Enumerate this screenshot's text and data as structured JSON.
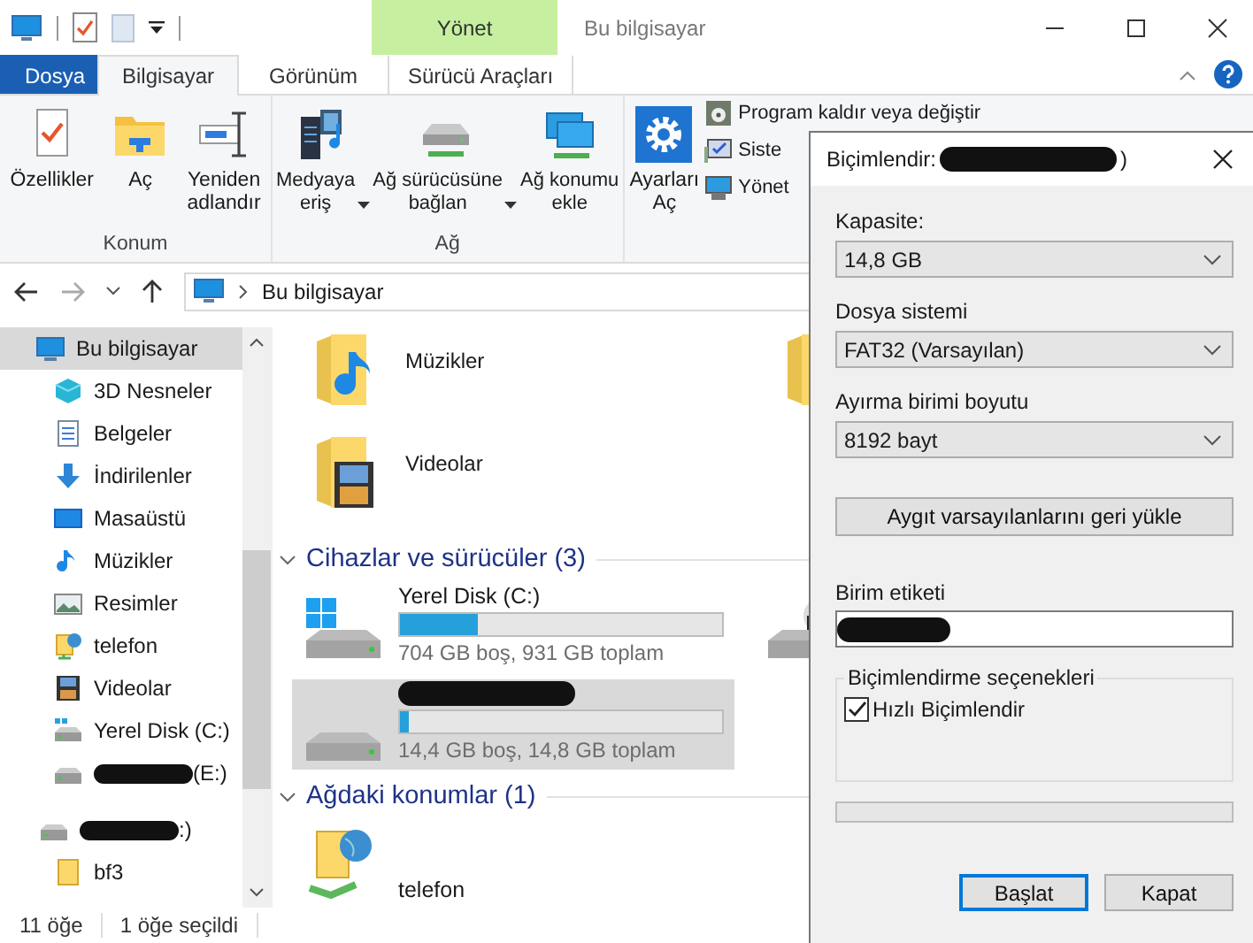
{
  "window": {
    "title": "Bu bilgisayar",
    "context_tab": "Yönet"
  },
  "ribbon_tabs": [
    {
      "label": "Dosya",
      "kind": "file",
      "selected": false
    },
    {
      "label": "Bilgisayar",
      "kind": "tab",
      "selected": true
    },
    {
      "label": "Görünüm",
      "kind": "tab",
      "selected": false
    },
    {
      "label": "Sürücü Araçları",
      "kind": "context",
      "selected": false
    }
  ],
  "ribbon_groups": [
    {
      "label": "Konum",
      "commands": [
        {
          "label": "Özellikler",
          "kind": "properties",
          "dropdown": false
        },
        {
          "label": "Aç",
          "kind": "open",
          "dropdown": false
        },
        {
          "label": "Yeniden\nadlandır",
          "kind": "rename",
          "dropdown": false
        }
      ]
    },
    {
      "label": "Ağ",
      "commands": [
        {
          "label": "Medyaya\neriş",
          "kind": "media",
          "dropdown": true
        },
        {
          "label": "Ağ sürücüsüne\nbağlan",
          "kind": "map-drive",
          "dropdown": true
        },
        {
          "label": "Ağ konumu\nekle",
          "kind": "network-location",
          "dropdown": false
        }
      ]
    },
    {
      "commands": [
        {
          "label": "Ayarları\nAç",
          "kind": "settings",
          "dropdown": false
        }
      ],
      "small_commands": [
        {
          "label": "Program kaldır veya değiştir",
          "kind": "uninstall"
        },
        {
          "label": "Siste",
          "kind": "system"
        },
        {
          "label": "Yönet",
          "kind": "manage"
        }
      ]
    }
  ],
  "address": {
    "path": "Bu bilgisayar"
  },
  "sidebar": {
    "items": [
      {
        "label": "Bu bilgisayar",
        "kind": "computer",
        "selected": true,
        "children": [
          {
            "label": "3D Nesneler",
            "kind": "cube",
            "selected": false
          },
          {
            "label": "Belgeler",
            "kind": "documents",
            "selected": false
          },
          {
            "label": "İndirilenler",
            "kind": "downloads",
            "selected": false
          },
          {
            "label": "Masaüstü",
            "kind": "desktop",
            "selected": false
          },
          {
            "label": "Müzikler",
            "kind": "music",
            "selected": false
          },
          {
            "label": "Resimler",
            "kind": "pictures",
            "selected": false
          },
          {
            "label": "telefon",
            "kind": "network",
            "selected": false
          },
          {
            "label": "Videolar",
            "kind": "videos",
            "selected": false
          },
          {
            "label": "Yerel Disk (C:)",
            "kind": "system-drive",
            "selected": false
          },
          {
            "label": "(E:)",
            "kind": "drive",
            "redacted": true,
            "selected": false
          }
        ]
      },
      {
        "label": ":)",
        "kind": "drive",
        "redacted": true,
        "selected": false,
        "children": [
          {
            "label": "bf3",
            "kind": "folder",
            "selected": false
          }
        ]
      }
    ]
  },
  "folders": [
    {
      "label": "Müzikler",
      "kind": "music"
    },
    {
      "kind": "pictures"
    },
    {
      "label": "Videolar",
      "kind": "videos"
    }
  ],
  "sections": [
    {
      "title": "Cihazlar ve sürücüler (3)",
      "expanded": true,
      "items": [
        {
          "kind": "system-drive",
          "name": "Yerel Disk (C:)",
          "level": 0.24,
          "space": "704 GB boş, 931 GB toplam",
          "selected": false
        },
        {
          "kind": "dvd",
          "selected": false
        },
        {
          "kind": "drive",
          "redacted": true,
          "level": 0.03,
          "space": "14,4 GB boş, 14,8 GB toplam",
          "selected": true
        }
      ]
    },
    {
      "title": "Ağdaki konumlar (1)",
      "expanded": true,
      "items": [
        {
          "kind": "network",
          "name": "telefon",
          "selected": false
        }
      ]
    }
  ],
  "status_bar": {
    "count": "11 öğe",
    "selection": "1 öğe seçildi"
  },
  "dialog": {
    "title": "Biçimlendir: ",
    "title_end": ")",
    "title_redacted": true,
    "fields": [
      {
        "label": "Kapasite:",
        "value": "14,8 GB"
      },
      {
        "label": "Dosya sistemi",
        "value": "FAT32 (Varsayılan)"
      },
      {
        "label": "Ayırma birimi boyutu",
        "value": "8192 bayt"
      }
    ],
    "restore_button": "Aygıt varsayılanlarını geri yükle",
    "volume_label": {
      "label": "Birim etiketi",
      "value_redacted": true
    },
    "options": {
      "title": "Biçimlendirme seçenekleri",
      "quick_format": {
        "label": "Hızlı Biçimlendir",
        "checked": true
      }
    },
    "progress": {
      "level": 0
    },
    "buttons": [
      {
        "label": "Başlat",
        "default": true
      },
      {
        "label": "Kapat",
        "default": false
      }
    ]
  }
}
